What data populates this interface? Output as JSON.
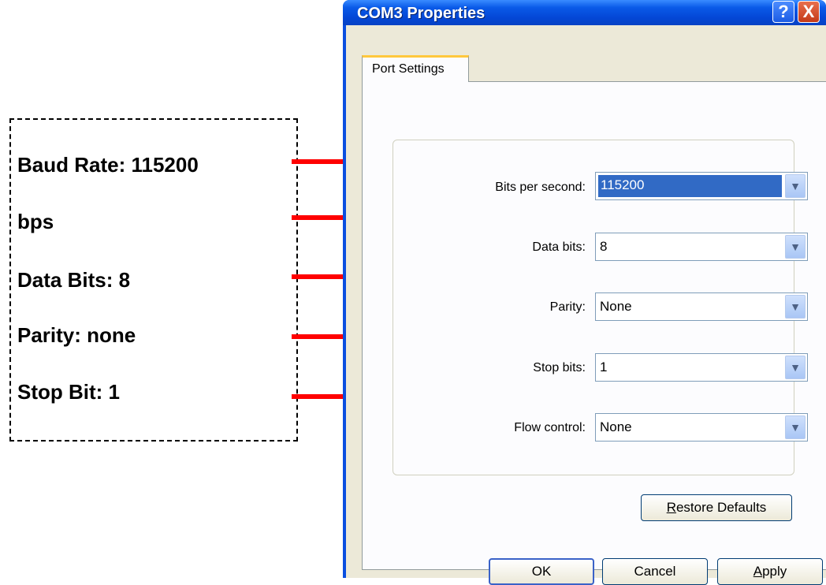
{
  "annotations": {
    "lines": [
      "Baud Rate: 115200",
      "bps",
      "Data Bits: 8",
      "Parity: none",
      "Stop Bit: 1"
    ]
  },
  "dialog": {
    "title": "COM3 Properties",
    "help_glyph": "?",
    "close_glyph": "X",
    "tab": "Port Settings",
    "fields": [
      {
        "label": "Bits per second:",
        "value": "115200"
      },
      {
        "label": "Data bits:",
        "value": "8"
      },
      {
        "label": "Parity:",
        "value": "None"
      },
      {
        "label": "Stop bits:",
        "value": "1"
      },
      {
        "label": "Flow control:",
        "value": "None"
      }
    ],
    "restore_defaults": "Restore Defaults",
    "ok": "OK",
    "cancel": "Cancel",
    "apply": "Apply",
    "dropdown_glyph": "▼"
  },
  "colors": {
    "arrow": "#ff0000",
    "titlebar": "#0a5ae8",
    "selection": "#316ac5"
  }
}
